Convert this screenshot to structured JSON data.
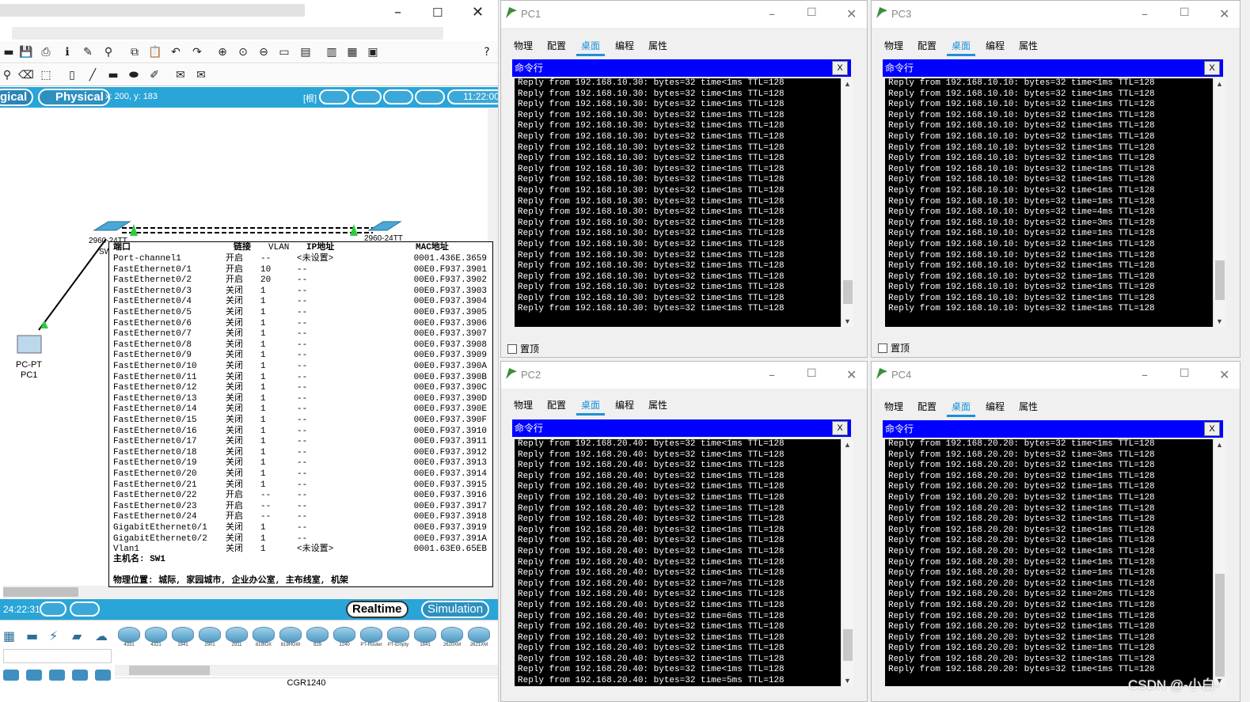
{
  "main": {
    "mode_logical": "gical",
    "mode_physical": "Physical",
    "coords": "x: 200, y: 183",
    "root_label": "[根]",
    "clock": "11:22:00",
    "sim_time": "24:22:31",
    "realtime_label": "Realtime",
    "simulation_label": "Simulation",
    "help_icon": "?",
    "selected_device": "CGR1240",
    "devices": [
      "4331",
      "4321",
      "1941",
      "2901",
      "2911",
      "819IOX",
      "819HGW",
      "829",
      "1240",
      "PT-Router",
      "PT-Empty",
      "1841",
      "2620XM",
      "2621XM"
    ],
    "topology": {
      "switch1_label": "2960-24TT",
      "switch1_name": "SW",
      "switch2_label": "2960-24TT",
      "pc_label": "PC-PT",
      "pc_name": "PC1"
    }
  },
  "popup": {
    "headers": {
      "port": "端口",
      "link": "链接",
      "vlan": "VLAN",
      "ip": "IP地址",
      "mac": "MAC地址"
    },
    "rows": [
      [
        "Port-channel1",
        "开启",
        "--",
        "<未设置>",
        "0001.436E.3659"
      ],
      [
        "FastEthernet0/1",
        "开启",
        "10",
        "--",
        "00E0.F937.3901"
      ],
      [
        "FastEthernet0/2",
        "开启",
        "20",
        "--",
        "00E0.F937.3902"
      ],
      [
        "FastEthernet0/3",
        "关闭",
        "1",
        "--",
        "00E0.F937.3903"
      ],
      [
        "FastEthernet0/4",
        "关闭",
        "1",
        "--",
        "00E0.F937.3904"
      ],
      [
        "FastEthernet0/5",
        "关闭",
        "1",
        "--",
        "00E0.F937.3905"
      ],
      [
        "FastEthernet0/6",
        "关闭",
        "1",
        "--",
        "00E0.F937.3906"
      ],
      [
        "FastEthernet0/7",
        "关闭",
        "1",
        "--",
        "00E0.F937.3907"
      ],
      [
        "FastEthernet0/8",
        "关闭",
        "1",
        "--",
        "00E0.F937.3908"
      ],
      [
        "FastEthernet0/9",
        "关闭",
        "1",
        "--",
        "00E0.F937.3909"
      ],
      [
        "FastEthernet0/10",
        "关闭",
        "1",
        "--",
        "00E0.F937.390A"
      ],
      [
        "FastEthernet0/11",
        "关闭",
        "1",
        "--",
        "00E0.F937.390B"
      ],
      [
        "FastEthernet0/12",
        "关闭",
        "1",
        "--",
        "00E0.F937.390C"
      ],
      [
        "FastEthernet0/13",
        "关闭",
        "1",
        "--",
        "00E0.F937.390D"
      ],
      [
        "FastEthernet0/14",
        "关闭",
        "1",
        "--",
        "00E0.F937.390E"
      ],
      [
        "FastEthernet0/15",
        "关闭",
        "1",
        "--",
        "00E0.F937.390F"
      ],
      [
        "FastEthernet0/16",
        "关闭",
        "1",
        "--",
        "00E0.F937.3910"
      ],
      [
        "FastEthernet0/17",
        "关闭",
        "1",
        "--",
        "00E0.F937.3911"
      ],
      [
        "FastEthernet0/18",
        "关闭",
        "1",
        "--",
        "00E0.F937.3912"
      ],
      [
        "FastEthernet0/19",
        "关闭",
        "1",
        "--",
        "00E0.F937.3913"
      ],
      [
        "FastEthernet0/20",
        "关闭",
        "1",
        "--",
        "00E0.F937.3914"
      ],
      [
        "FastEthernet0/21",
        "关闭",
        "1",
        "--",
        "00E0.F937.3915"
      ],
      [
        "FastEthernet0/22",
        "开启",
        "--",
        "--",
        "00E0.F937.3916"
      ],
      [
        "FastEthernet0/23",
        "开启",
        "--",
        "--",
        "00E0.F937.3917"
      ],
      [
        "FastEthernet0/24",
        "开启",
        "--",
        "--",
        "00E0.F937.3918"
      ],
      [
        "GigabitEthernet0/1",
        "关闭",
        "1",
        "--",
        "00E0.F937.3919"
      ],
      [
        "GigabitEthernet0/2",
        "关闭",
        "1",
        "--",
        "00E0.F937.391A"
      ],
      [
        "Vlan1",
        "关闭",
        "1",
        "<未设置>",
        "0001.63E0.65EB"
      ]
    ],
    "hostname": "主机名: SW1",
    "location": "物理位置: 城际, 家园城市, 企业办公室, 主布线室, 机架"
  },
  "pc_common": {
    "tabs": [
      "物理",
      "配置",
      "桌面",
      "编程",
      "属性"
    ],
    "cmd_title": "命令行",
    "cmd_close": "X",
    "pin_label": "置顶"
  },
  "pcs": [
    {
      "name": "PC1",
      "lines": [
        "Reply from 192.168.10.30: bytes=32 time<1ms TTL=128",
        "Reply from 192.168.10.30: bytes=32 time<1ms TTL=128",
        "Reply from 192.168.10.30: bytes=32 time<1ms TTL=128",
        "Reply from 192.168.10.30: bytes=32 time=1ms TTL=128",
        "Reply from 192.168.10.30: bytes=32 time<1ms TTL=128",
        "Reply from 192.168.10.30: bytes=32 time<1ms TTL=128",
        "Reply from 192.168.10.30: bytes=32 time<1ms TTL=128",
        "Reply from 192.168.10.30: bytes=32 time<1ms TTL=128",
        "Reply from 192.168.10.30: bytes=32 time<1ms TTL=128",
        "Reply from 192.168.10.30: bytes=32 time<1ms TTL=128",
        "Reply from 192.168.10.30: bytes=32 time<1ms TTL=128",
        "Reply from 192.168.10.30: bytes=32 time<1ms TTL=128",
        "Reply from 192.168.10.30: bytes=32 time<1ms TTL=128",
        "Reply from 192.168.10.30: bytes=32 time<1ms TTL=128",
        "Reply from 192.168.10.30: bytes=32 time<1ms TTL=128",
        "Reply from 192.168.10.30: bytes=32 time<1ms TTL=128",
        "Reply from 192.168.10.30: bytes=32 time<1ms TTL=128",
        "Reply from 192.168.10.30: bytes=32 time=1ms TTL=128",
        "Reply from 192.168.10.30: bytes=32 time<1ms TTL=128",
        "Reply from 192.168.10.30: bytes=32 time<1ms TTL=128",
        "Reply from 192.168.10.30: bytes=32 time<1ms TTL=128",
        "Reply from 192.168.10.30: bytes=32 time<1ms TTL=128"
      ]
    },
    {
      "name": "PC3",
      "lines": [
        "Reply from 192.168.10.10: bytes=32 time<1ms TTL=128",
        "Reply from 192.168.10.10: bytes=32 time<1ms TTL=128",
        "Reply from 192.168.10.10: bytes=32 time<1ms TTL=128",
        "Reply from 192.168.10.10: bytes=32 time<1ms TTL=128",
        "Reply from 192.168.10.10: bytes=32 time<1ms TTL=128",
        "Reply from 192.168.10.10: bytes=32 time<1ms TTL=128",
        "Reply from 192.168.10.10: bytes=32 time<1ms TTL=128",
        "Reply from 192.168.10.10: bytes=32 time<1ms TTL=128",
        "Reply from 192.168.10.10: bytes=32 time<1ms TTL=128",
        "Reply from 192.168.10.10: bytes=32 time<1ms TTL=128",
        "Reply from 192.168.10.10: bytes=32 time<1ms TTL=128",
        "Reply from 192.168.10.10: bytes=32 time=1ms TTL=128",
        "Reply from 192.168.10.10: bytes=32 time=4ms TTL=128",
        "Reply from 192.168.10.10: bytes=32 time=3ms TTL=128",
        "Reply from 192.168.10.10: bytes=32 time=1ms TTL=128",
        "Reply from 192.168.10.10: bytes=32 time<1ms TTL=128",
        "Reply from 192.168.10.10: bytes=32 time<1ms TTL=128",
        "Reply from 192.168.10.10: bytes=32 time<1ms TTL=128",
        "Reply from 192.168.10.10: bytes=32 time=1ms TTL=128",
        "Reply from 192.168.10.10: bytes=32 time<1ms TTL=128",
        "Reply from 192.168.10.10: bytes=32 time<1ms TTL=128",
        "Reply from 192.168.10.10: bytes=32 time<1ms TTL=128"
      ]
    },
    {
      "name": "PC2",
      "lines": [
        "Reply from 192.168.20.40: bytes=32 time<1ms TTL=128",
        "Reply from 192.168.20.40: bytes=32 time<1ms TTL=128",
        "Reply from 192.168.20.40: bytes=32 time<1ms TTL=128",
        "Reply from 192.168.20.40: bytes=32 time<1ms TTL=128",
        "Reply from 192.168.20.40: bytes=32 time<1ms TTL=128",
        "Reply from 192.168.20.40: bytes=32 time<1ms TTL=128",
        "Reply from 192.168.20.40: bytes=32 time=1ms TTL=128",
        "Reply from 192.168.20.40: bytes=32 time<1ms TTL=128",
        "Reply from 192.168.20.40: bytes=32 time<1ms TTL=128",
        "Reply from 192.168.20.40: bytes=32 time<1ms TTL=128",
        "Reply from 192.168.20.40: bytes=32 time<1ms TTL=128",
        "Reply from 192.168.20.40: bytes=32 time<1ms TTL=128",
        "Reply from 192.168.20.40: bytes=32 time<1ms TTL=128",
        "Reply from 192.168.20.40: bytes=32 time=7ms TTL=128",
        "Reply from 192.168.20.40: bytes=32 time<1ms TTL=128",
        "Reply from 192.168.20.40: bytes=32 time<1ms TTL=128",
        "Reply from 192.168.20.40: bytes=32 time=6ms TTL=128",
        "Reply from 192.168.20.40: bytes=32 time<1ms TTL=128",
        "Reply from 192.168.20.40: bytes=32 time<1ms TTL=128",
        "Reply from 192.168.20.40: bytes=32 time<1ms TTL=128",
        "Reply from 192.168.20.40: bytes=32 time<1ms TTL=128",
        "Reply from 192.168.20.40: bytes=32 time<1ms TTL=128",
        "Reply from 192.168.20.40: bytes=32 time=5ms TTL=128"
      ]
    },
    {
      "name": "PC4",
      "lines": [
        "Reply from 192.168.20.20: bytes=32 time<1ms TTL=128",
        "Reply from 192.168.20.20: bytes=32 time=3ms TTL=128",
        "Reply from 192.168.20.20: bytes=32 time<1ms TTL=128",
        "Reply from 192.168.20.20: bytes=32 time<1ms TTL=128",
        "Reply from 192.168.20.20: bytes=32 time=1ms TTL=128",
        "Reply from 192.168.20.20: bytes=32 time<1ms TTL=128",
        "Reply from 192.168.20.20: bytes=32 time<1ms TTL=128",
        "Reply from 192.168.20.20: bytes=32 time<1ms TTL=128",
        "Reply from 192.168.20.20: bytes=32 time<1ms TTL=128",
        "Reply from 192.168.20.20: bytes=32 time<1ms TTL=128",
        "Reply from 192.168.20.20: bytes=32 time<1ms TTL=128",
        "Reply from 192.168.20.20: bytes=32 time<1ms TTL=128",
        "Reply from 192.168.20.20: bytes=32 time=1ms TTL=128",
        "Reply from 192.168.20.20: bytes=32 time<1ms TTL=128",
        "Reply from 192.168.20.20: bytes=32 time=2ms TTL=128",
        "Reply from 192.168.20.20: bytes=32 time<1ms TTL=128",
        "Reply from 192.168.20.20: bytes=32 time<1ms TTL=128",
        "Reply from 192.168.20.20: bytes=32 time<1ms TTL=128",
        "Reply from 192.168.20.20: bytes=32 time<1ms TTL=128",
        "Reply from 192.168.20.20: bytes=32 time=1ms TTL=128",
        "Reply from 192.168.20.20: bytes=32 time<1ms TTL=128",
        "Reply from 192.168.20.20: bytes=32 time<1ms TTL=128"
      ]
    }
  ],
  "watermark": "CSDN @-小白-",
  "colors": {
    "accent": "#29a5d8",
    "cmd_header": "#0000ff",
    "tab_active": "#1e8fd8"
  }
}
